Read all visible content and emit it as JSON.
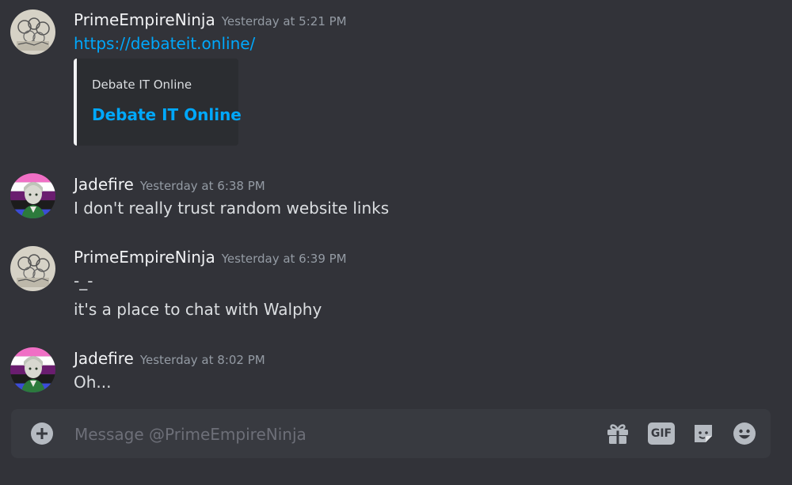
{
  "messages": [
    {
      "username": "PrimeEmpireNinja",
      "timestamp": "Yesterday at 5:21 PM",
      "link": "https://debateit.online/",
      "embed": {
        "provider": "Debate IT Online",
        "title": "Debate IT Online"
      }
    },
    {
      "username": "Jadefire",
      "timestamp": "Yesterday at 6:38 PM",
      "text": "I don't really trust random website links"
    },
    {
      "username": "PrimeEmpireNinja",
      "timestamp": "Yesterday at 6:39 PM",
      "lines": [
        "-_-",
        "it's a place to chat with Walphy"
      ]
    },
    {
      "username": "Jadefire",
      "timestamp": "Yesterday at 8:02 PM",
      "text": "Oh..."
    }
  ],
  "composer": {
    "placeholder": "Message @PrimeEmpireNinja",
    "gif_label": "GIF"
  },
  "icons": {
    "attach": "plus-circle-icon",
    "gift": "gift-icon",
    "gif": "gif-icon",
    "sticker": "sticker-icon",
    "emoji": "emoji-icon"
  },
  "colors": {
    "background": "#323339",
    "link": "#00a8fc",
    "username": "#f2f3f5",
    "timestamp": "#949ba4"
  }
}
